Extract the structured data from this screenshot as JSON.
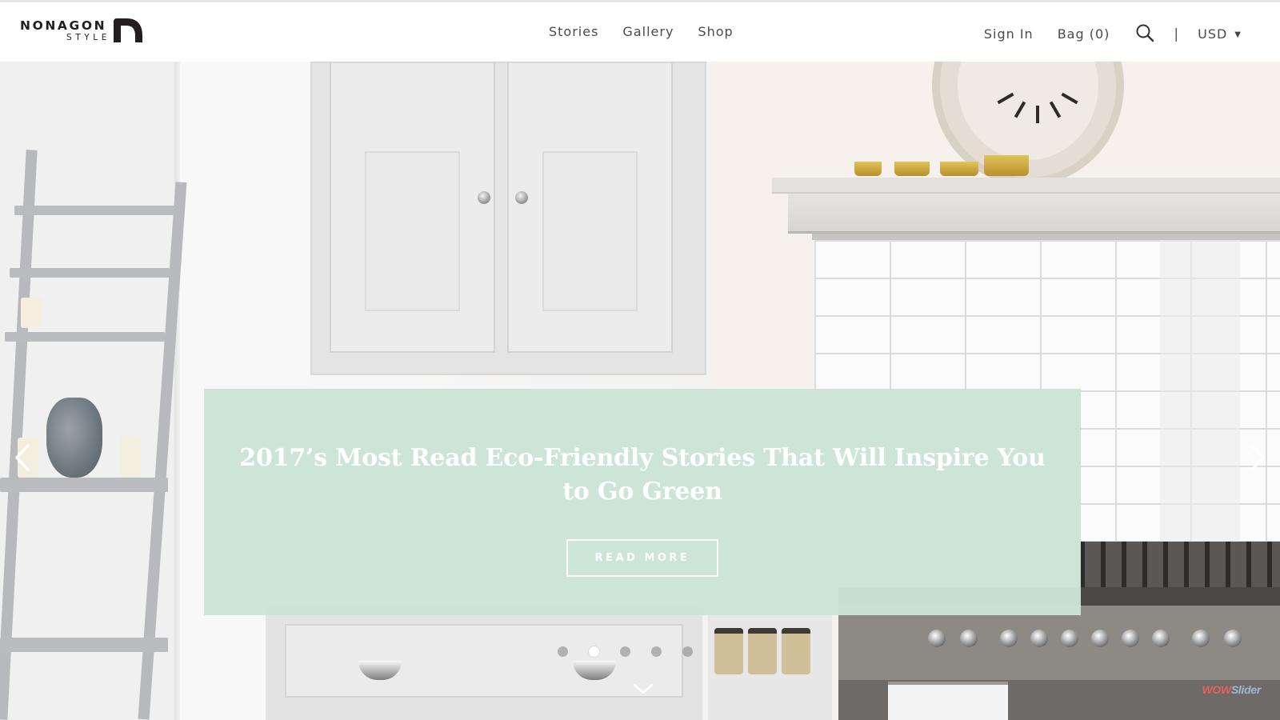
{
  "header": {
    "logo": {
      "word": "NONAGON",
      "sub": "STYLE",
      "icon": "nonagon-arch-logo-mark"
    },
    "nav": [
      {
        "label": "Stories"
      },
      {
        "label": "Gallery"
      },
      {
        "label": "Shop"
      }
    ],
    "sign_in": "Sign In",
    "bag": "Bag (0)",
    "search_icon": "search-icon",
    "divider": "|",
    "currency": {
      "selected": "USD",
      "icon": "chevron-down-icon"
    }
  },
  "hero": {
    "caption_title": "2017’s Most Read Eco-Friendly Stories That Will Inspire You to Go Green",
    "cta_label": "READ MORE",
    "prev_icon": "chevron-left-icon",
    "next_icon": "chevron-right-icon",
    "scroll_icon": "chevron-down-icon",
    "slides_total": 5,
    "active_slide": 2,
    "watermark": {
      "part1": "WOW",
      "part2": "Slider"
    },
    "caption_bg": "#cae4d5"
  }
}
